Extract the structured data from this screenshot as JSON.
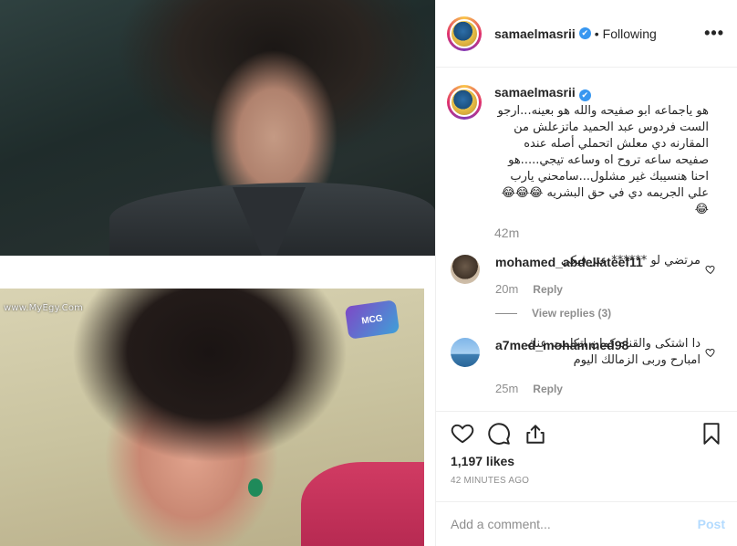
{
  "media": {
    "watermark": "www.MyEgy.Com",
    "channel_logo": "MCG"
  },
  "header": {
    "username": "samaelmasrii",
    "verified": "✔",
    "separator": "•",
    "follow_status": "Following",
    "more": "•••"
  },
  "caption": {
    "username": "samaelmasrii",
    "text": "هو ياجماعه ابو صفيحه والله هو بعينه...ارجو الست فردوس عبد الحميد ماتزعلش من المقارنه دي معلش اتحملي أصله عنده صفيحه ساعه تروح اه وساعه تيجي.....هو احنا هنسيبك غير مشلول...سامحني يارب علي الجريمه دي في حق البشريه 😂😂😂😂",
    "time": "42m"
  },
  "comments": [
    {
      "username": "mohamed_abdellateef11",
      "text": "مرتضي لو ****** عتر فيكي",
      "time": "20m",
      "reply": "Reply",
      "view_replies": "View replies (3)"
    },
    {
      "username": "a7med_mohammed98",
      "text": "دا اشتكى والقناه كمان اتكلمت عنك امبارح وربى الزمالك اليوم",
      "time": "25m",
      "reply": "Reply"
    }
  ],
  "actions": {
    "likes": "1,197 likes",
    "timestamp": "42 minutes ago"
  },
  "add_comment": {
    "placeholder": "Add a comment...",
    "post": "Post"
  }
}
